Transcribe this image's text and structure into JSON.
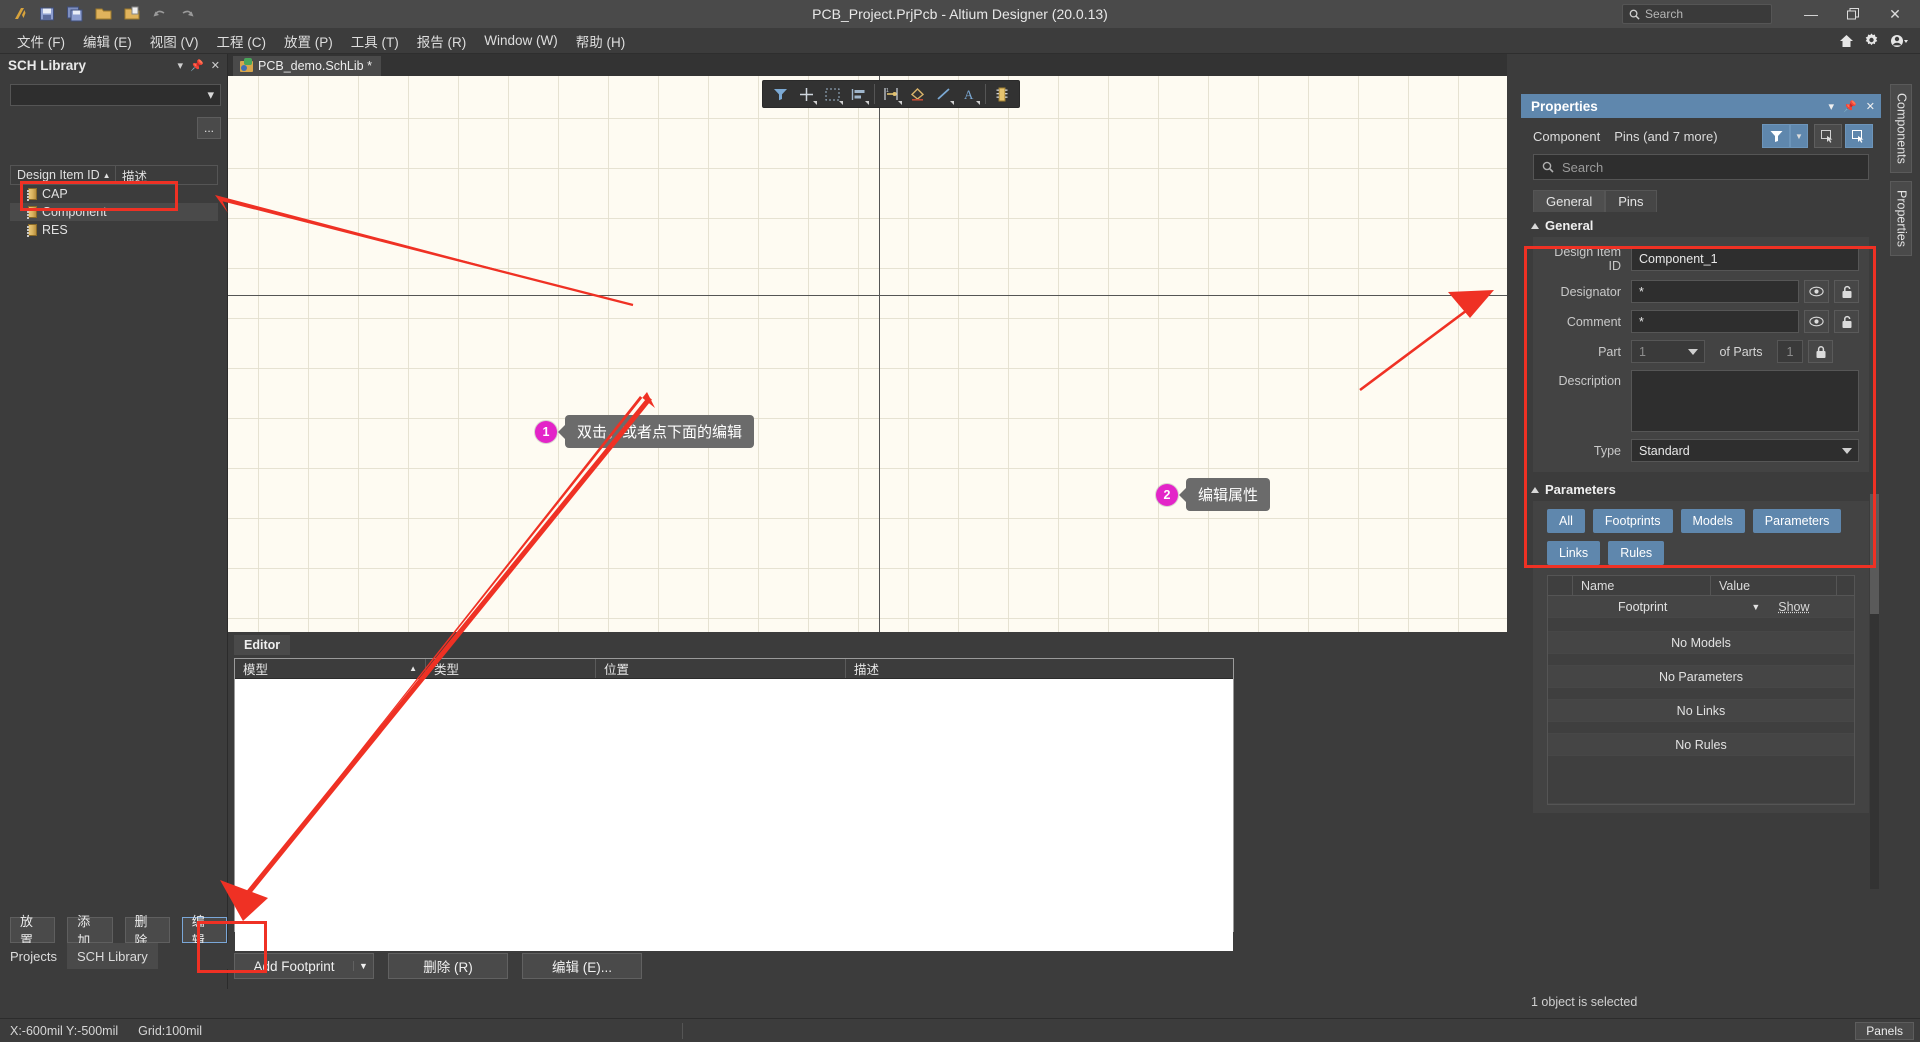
{
  "titlebar": {
    "title": "PCB_Project.PrjPcb - Altium Designer (20.0.13)",
    "search_placeholder": "Search",
    "quick_access": [
      "altium-logo-icon",
      "save-icon",
      "save-all-icon",
      "open-icon",
      "open-project-icon",
      "undo-icon",
      "redo-icon"
    ],
    "window_buttons": {
      "minimize": "—",
      "restore": "❐",
      "close": "✕"
    }
  },
  "menubar": {
    "items": [
      {
        "label": "文件 (F)",
        "accel": "F"
      },
      {
        "label": "编辑 (E)",
        "accel": "E"
      },
      {
        "label": "视图 (V)",
        "accel": "V"
      },
      {
        "label": "工程 (C)",
        "accel": "C"
      },
      {
        "label": "放置 (P)",
        "accel": "P"
      },
      {
        "label": "工具 (T)",
        "accel": "T"
      },
      {
        "label": "报告 (R)",
        "accel": "R"
      },
      {
        "label": "Window (W)",
        "accel": "W"
      },
      {
        "label": "帮助 (H)",
        "accel": "H"
      }
    ],
    "right_icons": [
      "home-icon",
      "gear-icon",
      "user-account-icon"
    ]
  },
  "left_panel": {
    "title": "SCH Library",
    "header_icons": [
      "chevron-down-icon",
      "pin-icon",
      "close-icon"
    ],
    "library_select_value": "",
    "ellipsis_label": "...",
    "columns": [
      "Design Item ID",
      "描述"
    ],
    "sort_indicator": "▲",
    "items": [
      {
        "label": "CAP",
        "selected": false
      },
      {
        "label": "Component",
        "selected": true
      },
      {
        "label": "RES",
        "selected": false
      }
    ],
    "buttons": [
      {
        "label": "放置",
        "focused": false
      },
      {
        "label": "添加",
        "focused": false
      },
      {
        "label": "删除",
        "focused": false
      },
      {
        "label": "编辑",
        "focused": true
      }
    ],
    "bottom_tabs": [
      {
        "label": "Projects",
        "active": false
      },
      {
        "label": "SCH Library",
        "active": true
      }
    ]
  },
  "document_tabs": [
    {
      "label": "PCB_demo.SchLib *",
      "active": true
    }
  ],
  "canvas": {
    "toolbar_icons": [
      "filter-icon",
      "crosshair-icon",
      "selection-box-icon",
      "align-icon",
      "pin-place-icon",
      "polygon-icon",
      "line-icon",
      "text-icon",
      "component-icon"
    ],
    "callouts": [
      {
        "number": "1",
        "text": "双击，或者点下面的编辑"
      },
      {
        "number": "2",
        "text": "编辑属性"
      }
    ]
  },
  "editor_panel": {
    "tab_label": "Editor",
    "columns": [
      "模型",
      "类型",
      "位置",
      "描述"
    ],
    "sort_indicator": "▲",
    "rows": [],
    "buttons": [
      {
        "label": "Add Footprint",
        "underline": "A",
        "has_dropdown": true
      },
      {
        "label": "删除 (R)",
        "underline": "R",
        "has_dropdown": false
      },
      {
        "label": "编辑 (E)...",
        "underline": "E",
        "has_dropdown": false
      }
    ]
  },
  "properties_panel": {
    "title": "Properties",
    "header_icons": [
      "chevron-down-icon",
      "pin-icon",
      "close-icon"
    ],
    "object_type": "Component",
    "object_scope": "Pins (and 7 more)",
    "toolbar_icons": [
      "funnel-icon",
      "chevron-down-icon",
      "select-all-icon",
      "zoom-to-fit-icon"
    ],
    "search_placeholder": "Search",
    "tabs": [
      {
        "label": "General",
        "active": true
      },
      {
        "label": "Pins",
        "active": false
      }
    ],
    "general": {
      "section_title": "General",
      "fields": {
        "design_item_id_label": "Design Item ID",
        "design_item_id_value": "Component_1",
        "designator_label": "Designator",
        "designator_value": "*",
        "comment_label": "Comment",
        "comment_value": "*",
        "part_label": "Part",
        "part_value": "1",
        "of_parts_label": "of Parts",
        "of_parts_value": "1",
        "description_label": "Description",
        "description_value": "",
        "type_label": "Type",
        "type_value": "Standard"
      },
      "row_icons": [
        "eye-icon",
        "unlock-icon",
        "lock-icon"
      ]
    },
    "parameters": {
      "section_title": "Parameters",
      "filter_buttons": [
        "All",
        "Footprints",
        "Models",
        "Parameters",
        "Links",
        "Rules"
      ],
      "columns": [
        "Name",
        "Value"
      ],
      "rows": [
        {
          "name": "Footprint",
          "value": "",
          "action": "Show"
        }
      ],
      "empty_rows": [
        "No Models",
        "No Parameters",
        "No Links",
        "No Rules"
      ]
    },
    "status": "1 object is selected"
  },
  "vertical_tabs": [
    {
      "label": "Components"
    },
    {
      "label": "Properties"
    }
  ],
  "statusbar": {
    "coordinates": "X:-600mil Y:-500mil",
    "grid": "Grid:100mil",
    "panels_button": "Panels"
  },
  "colors": {
    "accent_blue": "#5f87ad",
    "annotation_red": "#ef3124",
    "callout_magenta": "#e324c8",
    "canvas_bg": "#fefbf2",
    "chrome": "#3c3c3c"
  }
}
